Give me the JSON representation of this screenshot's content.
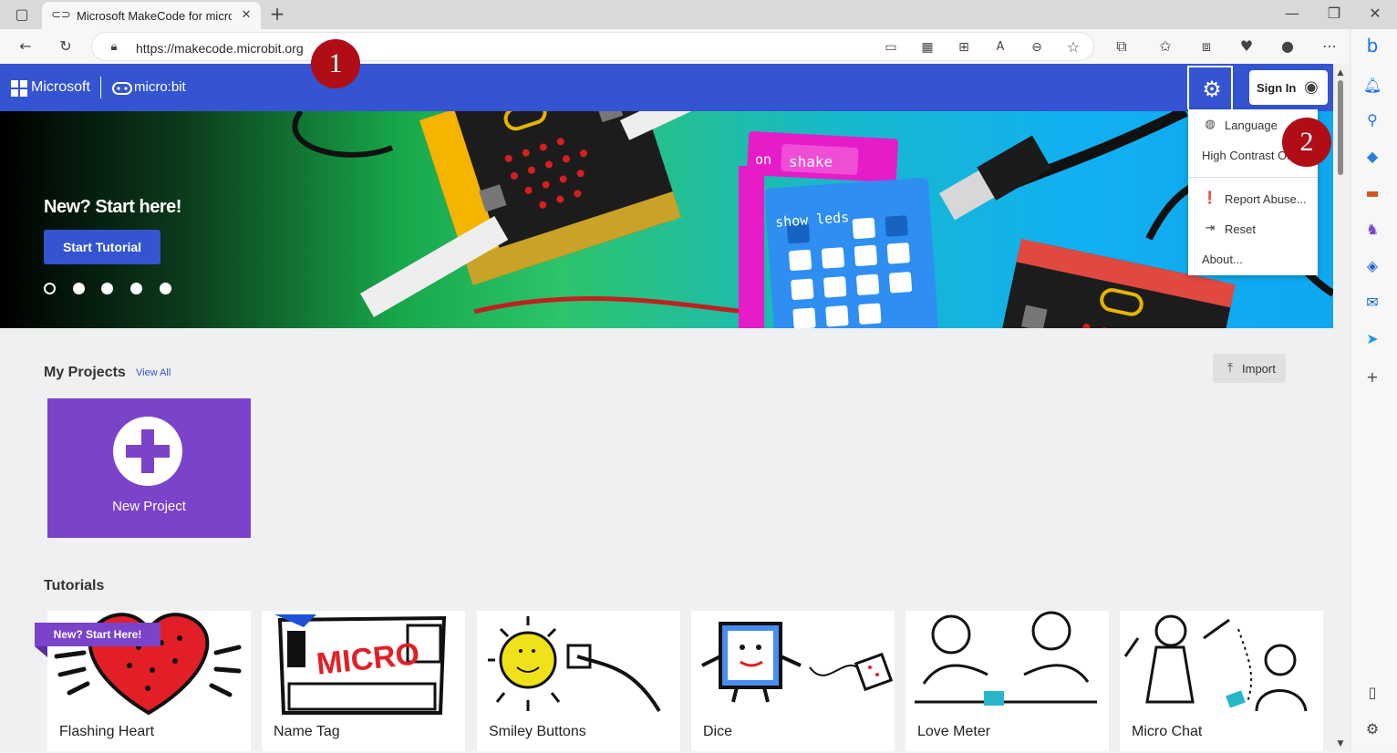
{
  "browser": {
    "tab_title": "Microsoft MakeCode for micro:bit",
    "url": "https://makecode.microbit.org",
    "tab_close": "✕",
    "new_tab": "+"
  },
  "header": {
    "ms_label": "Microsoft",
    "brand_label": "micro:bit",
    "signin_label": "Sign In"
  },
  "hero": {
    "title": "New? Start here!",
    "start_button": "Start Tutorial",
    "block_on": "on",
    "block_shake": "shake",
    "block_show_leds": "show leds"
  },
  "settings_menu": {
    "items": [
      "Language",
      "High Contrast On",
      "Report Abuse...",
      "Reset",
      "About..."
    ]
  },
  "my_projects": {
    "title": "My Projects",
    "view_all": "View All",
    "import_label": "Import",
    "new_project_label": "New Project"
  },
  "tutorials": {
    "title": "Tutorials",
    "ribbon": "New? Start Here!",
    "cards": [
      "Flashing Heart",
      "Name Tag",
      "Smiley Buttons",
      "Dice",
      "Love Meter",
      "Micro Chat"
    ],
    "name_tag_text": "MICRO"
  },
  "callouts": [
    "1",
    "2"
  ],
  "colors": {
    "header_blue": "#3454d1",
    "purple": "#7b43c9",
    "callout_red": "#b00d16"
  }
}
